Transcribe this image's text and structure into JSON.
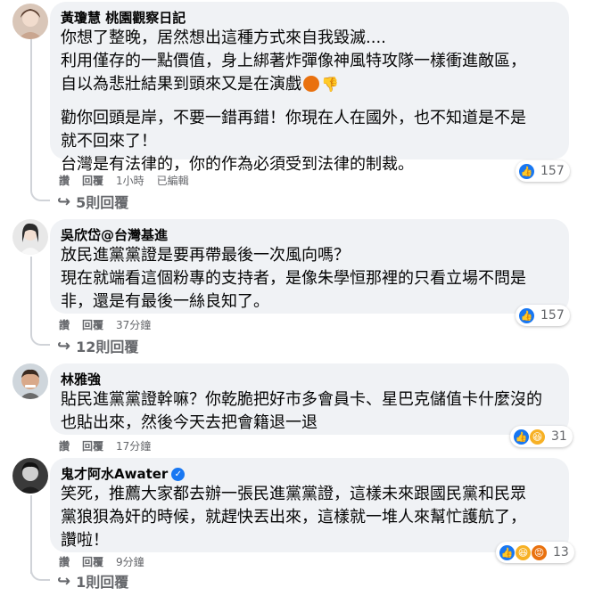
{
  "comments": [
    {
      "author": "黃瓊慧 桃園觀察日記",
      "lines": [
        "你想了整晚，居然想出這種方式來自我毀滅....",
        "利用僅存的一點價值，身上綁著炸彈像神風特攻隊一樣衝進敵區，",
        "自以為悲壯結果到頭來又是在演戲"
      ],
      "lines2": [
        "勸你回頭是岸，不要一錯再錯！你現在人在國外，也不知道是不是",
        "就不回來了！",
        "台灣是有法律的，你的作為必須受到法律的制裁。"
      ],
      "emojis": [
        "angry-emoji",
        "thumbs-down-emoji"
      ],
      "actions": {
        "like": "讚",
        "reply": "回覆",
        "time": "1小時",
        "edited": "已編輯"
      },
      "reactions": {
        "icons": [
          "like-icon"
        ],
        "count": "157"
      },
      "replies": "5則回覆"
    },
    {
      "author": "吳欣岱@台灣基進",
      "lines": [
        "放民進黨黨證是要再帶最後一次風向嗎？",
        "現在就端看這個粉專的支持者，是像朱學恒那裡的只看立場不問是",
        "非，還是有最後一絲良知了。"
      ],
      "actions": {
        "like": "讚",
        "reply": "回覆",
        "time": "37分鐘"
      },
      "reactions": {
        "icons": [
          "like-icon"
        ],
        "count": "157"
      },
      "replies": "12則回覆"
    },
    {
      "author": "林雅強",
      "lines": [
        "貼民進黨黨證幹嘛？你乾脆把好市多會員卡、星巴克儲值卡什麼沒的",
        "也貼出來，然後今天去把會籍退一退"
      ],
      "actions": {
        "like": "讚",
        "reply": "回覆",
        "time": "17分鐘"
      },
      "reactions": {
        "icons": [
          "like-icon",
          "haha-icon"
        ],
        "count": "31"
      }
    },
    {
      "author": "鬼才阿水Awater",
      "verified": true,
      "lines": [
        "笑死，推薦大家都去辦一張民進黨黨證，這樣未來跟國民黨和民眾",
        "黨狼狽為奸的時候，就趕快丟出來，這樣就一堆人來幫忙護航了，",
        "讚啦！"
      ],
      "actions": {
        "like": "讚",
        "reply": "回覆",
        "time": "9分鐘"
      },
      "reactions": {
        "icons": [
          "like-icon",
          "haha-icon",
          "angry-icon"
        ],
        "count": "13"
      },
      "replies": "1則回覆"
    }
  ],
  "colors": {
    "bubble": "#f0f2f5",
    "like": "#1877f2",
    "meta": "#65676b"
  }
}
